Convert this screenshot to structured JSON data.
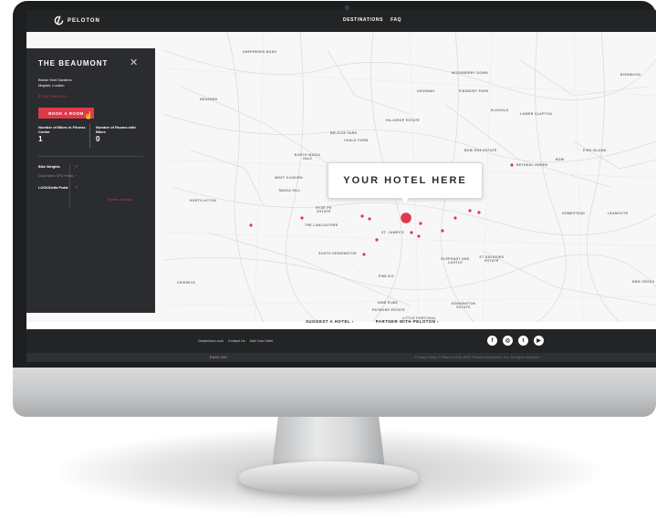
{
  "brand": {
    "name": "PELOTON"
  },
  "nav": {
    "items": [
      "DESTINATIONS",
      "FAQ"
    ]
  },
  "panel": {
    "title": "THE BEAUMONT",
    "address_line1": "Brown Hart Gardens",
    "address_line2": "Mayfair, London",
    "phone": "020 7499 1001",
    "book_label": "BOOK A ROOM",
    "stat_bikes_label": "Number of Bikes in Fitness Center",
    "stat_bikes_value": "1",
    "stat_rooms_label": "Number of Rooms with Bikes",
    "stat_rooms_value": "0",
    "equipment": [
      {
        "label": "Bike Weights",
        "sub": ""
      },
      {
        "label": "",
        "sub": "Dual Sided SPD Pedal"
      },
      {
        "label": "LOOK/Delta Pedal",
        "sub": ""
      }
    ],
    "rooms_link": "Rooms on Book"
  },
  "map": {
    "callout": "YOUR HOTEL HERE",
    "labels": [
      "SHEPHERDS BUSH",
      "NEASDEN",
      "WOODBERRY DOWN",
      "ARCHWAY",
      "FINSBURY PARK",
      "ELDGOLD",
      "LOWER CLAPTON",
      "HILLDROP ESTATE",
      "BELSIZE PARK",
      "CHALK FARM",
      "NORTH MAIDA VALE",
      "WEST KILBURN",
      "MAIDA HILL",
      "NORTH ACTON",
      "BOW",
      "FISH ISLAND",
      "BETHNAL GREEN",
      "HYDE PK ESTATE",
      "THE LANCASTERS",
      "ST. JAMES'S",
      "SOUTH KENSINGTON",
      "ELEPHANT AND CASTLE",
      "ST SAVIOURS ESTATE",
      "PIMLICO",
      "CHISWICK",
      "NINE ELMS",
      "PATMORE ESTATE",
      "KENNINGTON ESTATE",
      "LITTLE PORTUGAL",
      "LEAMOUTH",
      "BISHWOOD",
      "BOW ERA ESTATE",
      "HOMESTEAD",
      "NEW CROSS"
    ]
  },
  "map_footer": {
    "suggest": "SUGGEST A HOTEL",
    "partner": "PARTNER WITH PELOTON"
  },
  "footer": {
    "links": [
      "Onepeloton.com",
      "Contact Us",
      "Add Your Hotel"
    ],
    "socials": [
      "f",
      "◎",
      "t",
      "▶"
    ],
    "language": "ENGLISH",
    "legal": "Privacy Policy     © Peloton 2016-2022. Peloton Interactive, Inc. All rights reserved."
  }
}
